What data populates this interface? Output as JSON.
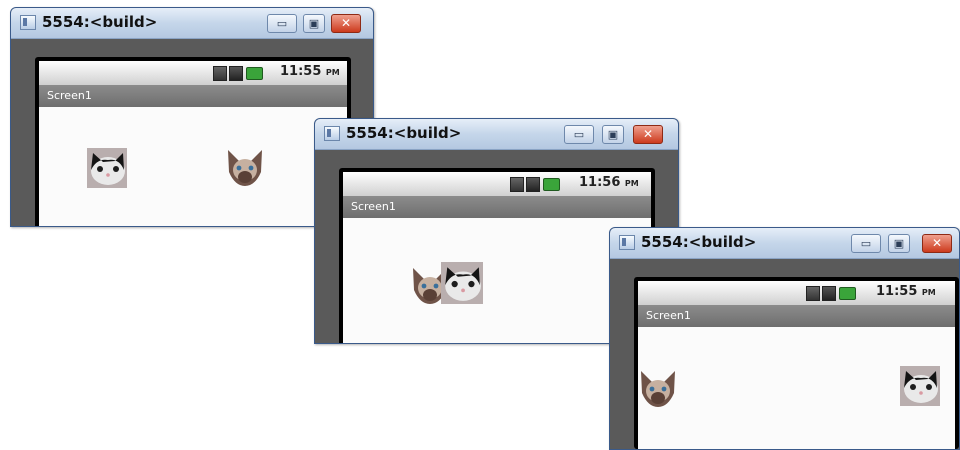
{
  "windows": [
    {
      "title": "5554:<build>",
      "status": {
        "clock": "11:55",
        "ampm": "PM"
      },
      "screen_label": "Screen1",
      "sprites": [
        "black-white-cat-face",
        "siamese-cat-face"
      ]
    },
    {
      "title": "5554:<build>",
      "status": {
        "clock": "11:56",
        "ampm": "PM"
      },
      "screen_label": "Screen1",
      "sprites": [
        "siamese-cat-face",
        "black-white-cat-face"
      ]
    },
    {
      "title": "5554:<build>",
      "status": {
        "clock": "11:55",
        "ampm": "PM"
      },
      "screen_label": "Screen1",
      "sprites": [
        "siamese-cat-face",
        "black-white-cat-face"
      ]
    }
  ],
  "window_controls": {
    "minimize": "▭",
    "maximize": "▣",
    "close": "✕"
  },
  "colors": {
    "titlebar": "#c5d6ea",
    "emulator_frame": "#5a5a5a",
    "app_bar": "#7d7d7d",
    "canvas": "#fbfbfb",
    "battery": "#3aa43a"
  },
  "icons": [
    "app-icon",
    "3g-icon",
    "signal-icon",
    "battery-icon",
    "minimize-icon",
    "maximize-icon",
    "close-icon"
  ]
}
